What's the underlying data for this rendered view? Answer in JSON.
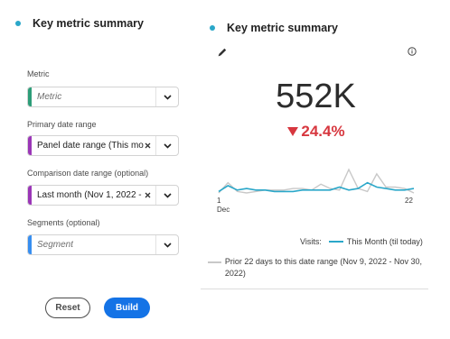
{
  "left_panel": {
    "title": "Key metric summary",
    "fields": {
      "metric": {
        "label": "Metric",
        "placeholder": "Metric",
        "accent": "#2d9d78"
      },
      "primary_date": {
        "label": "Primary date range",
        "value": "Panel date range (This mon...",
        "accent": "#9b36b7"
      },
      "comparison_date": {
        "label": "Comparison date range (optional)",
        "value": "Last month (Nov 1, 2022 - N...",
        "accent": "#9b36b7"
      },
      "segments": {
        "label": "Segments (optional)",
        "placeholder": "Segment",
        "accent": "#378ef0"
      }
    },
    "buttons": {
      "reset": "Reset",
      "build": "Build"
    }
  },
  "right_panel": {
    "title": "Key metric summary",
    "value": "552K",
    "change": "24.4%",
    "change_direction": "down",
    "icons": [
      "pencil-icon",
      "info-icon"
    ],
    "colors": {
      "current": "#2aa7c9",
      "prior": "#c8c8c8",
      "negative": "#d7373f",
      "accent_dot": "#2aa7c9"
    },
    "chart_data": {
      "type": "line",
      "x_labels": {
        "start": "1",
        "start_sub": "Dec",
        "end": "22"
      },
      "series": [
        {
          "name": "This Month (til today)",
          "values": [
            60,
            64,
            61,
            62,
            61,
            61,
            60,
            60,
            60,
            61,
            61,
            61,
            61,
            63,
            61,
            62,
            66,
            63,
            62,
            61,
            61,
            62
          ]
        },
        {
          "name": "Prior 22 days to this date range (Nov 9, 2022 - Nov 30, 2022)",
          "values": [
            59,
            66,
            60,
            59,
            60,
            61,
            61,
            61,
            62,
            62,
            61,
            65,
            62,
            61,
            75,
            62,
            60,
            72,
            63,
            63,
            62,
            59
          ]
        }
      ]
    },
    "legend": {
      "prefix": "Visits:",
      "current": "This Month (til today)",
      "prior": "Prior 22 days to this date range (Nov 9, 2022 - Nov 30, 2022)"
    }
  }
}
